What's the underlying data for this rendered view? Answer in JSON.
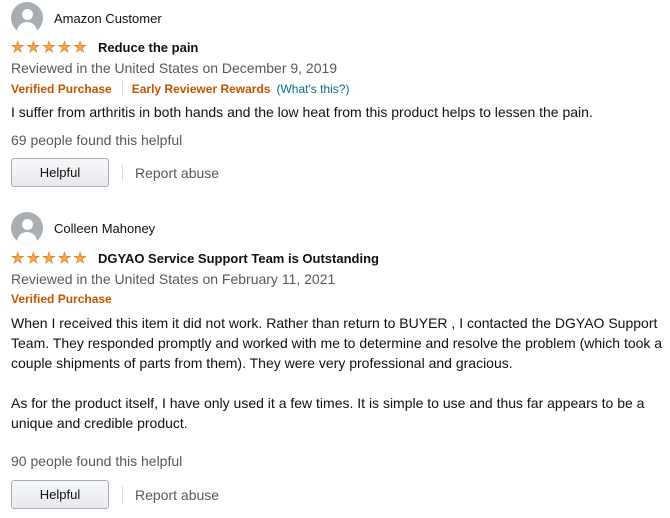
{
  "reviews": [
    {
      "reviewer": "Amazon Customer",
      "rating": 5,
      "title": "Reduce the pain",
      "date_line": "Reviewed in the United States on December 9, 2019",
      "verified": "Verified Purchase",
      "early_reviewer": "Early Reviewer Rewards",
      "whats_this": "(What's this?)",
      "body": [
        "I suffer from arthritis in both hands and the low heat from this product helps to lessen the pain."
      ],
      "helpful_count": "69 people found this helpful",
      "helpful_label": "Helpful",
      "report_label": "Report abuse"
    },
    {
      "reviewer": "Colleen Mahoney",
      "rating": 5,
      "title": "DGYAO Service Support Team is Outstanding",
      "date_line": "Reviewed in the United States on February 11, 2021",
      "verified": "Verified Purchase",
      "body": [
        "When I received this item it did not work. Rather than return to  BUYER  , I contacted the DGYAO Support Team. They responded promptly and worked with me to determine and resolve the problem (which took a couple shipments of parts from them). They were very professional and gracious.",
        "As for the product itself, I have only used it a few times. It is simple to use and thus far appears to be a unique and credible product."
      ],
      "helpful_count": "90 people found this helpful",
      "helpful_label": "Helpful",
      "report_label": "Report abuse"
    }
  ],
  "colors": {
    "star": "#f3a847",
    "verified": "#c45500",
    "link": "#007185",
    "muted": "#565959"
  }
}
